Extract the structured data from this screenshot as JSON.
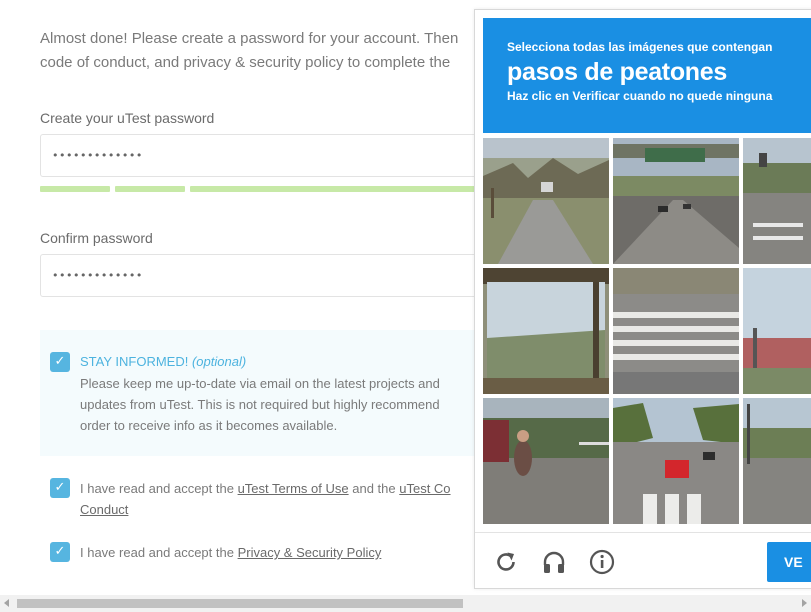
{
  "signup": {
    "intro_line1": "Almost done! Please create a password for your account. Then",
    "intro_line2": "code of conduct, and privacy & security policy to complete the",
    "password_label": "Create your uTest password",
    "password_value": "•••••••••••••",
    "confirm_label": "Confirm password",
    "confirm_value": "•••••••••••••",
    "stay_informed": {
      "title": "STAY INFORMED!",
      "optional": "(optional)",
      "line1": "Please keep me up-to-date via email on the latest projects and",
      "line2": "updates from uTest. This is not required but highly recommend",
      "line3": "order to receive info as it becomes available.",
      "checked": true
    },
    "terms": {
      "prefix": "I have read and accept the",
      "link1": "uTest Terms of Use",
      "middle": "and the",
      "link2": "uTest Co",
      "line2_link": "Conduct",
      "checked": true
    },
    "privacy": {
      "prefix": "I have read and accept the",
      "link": "Privacy & Security Policy",
      "checked": true
    },
    "password_strength_segments": 3
  },
  "captcha": {
    "instruction": "Selecciona todas las imágenes que contengan",
    "keyword": "pasos de peatones",
    "hint": "Haz clic en Verificar cuando no quede ninguna",
    "verify_label": "VE",
    "icons": [
      "reload-icon",
      "audio-headphones-icon",
      "info-icon"
    ],
    "tile_count": 9,
    "colors": {
      "header": "#1a8fe3",
      "checkbox": "#56b5e0",
      "strength": "#c7e9a7"
    }
  }
}
